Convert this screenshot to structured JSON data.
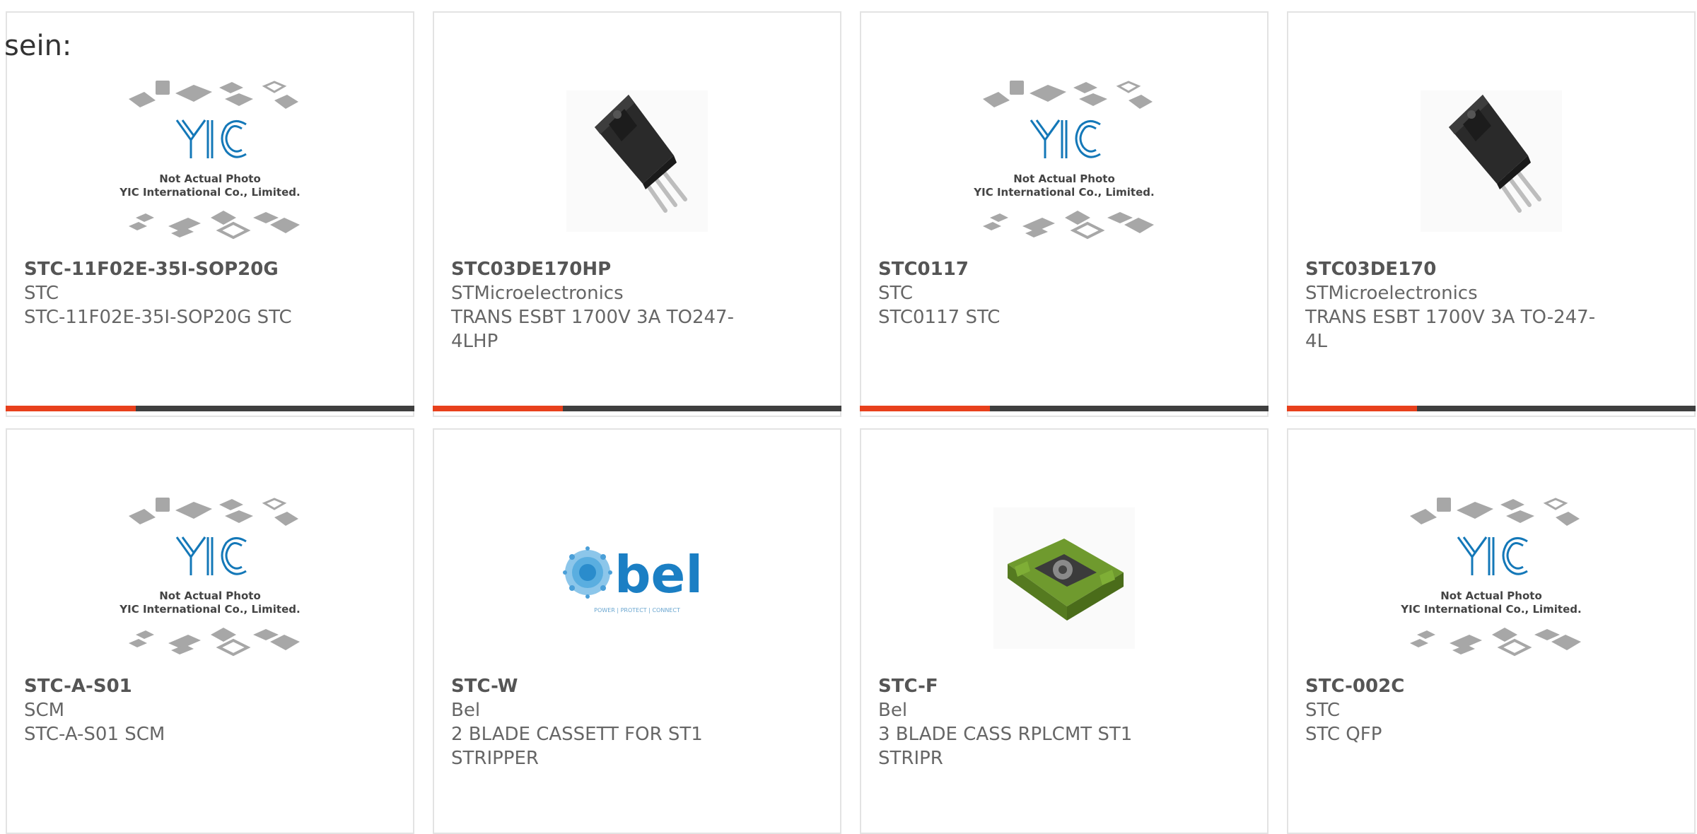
{
  "intro_text": "sein:",
  "placeholder_text": {
    "line1": "Not Actual Photo",
    "line2": "YIC International Co., Limited.",
    "logo": "YIC"
  },
  "bel_logo": {
    "name": "bel",
    "tagline": "POWER | PROTECT | CONNECT"
  },
  "colors": {
    "accent": "#e8401c",
    "bar": "#3f3f3f",
    "blue": "#1478b8",
    "border": "#e3e3e3"
  },
  "products": [
    {
      "part": "STC-11F02E-35I-SOP20G",
      "manufacturer": "STC",
      "description": "STC-11F02E-35I-SOP20G STC",
      "image": "yic-placeholder"
    },
    {
      "part": "STC03DE170HP",
      "manufacturer": "STMicroelectronics",
      "description": "TRANS ESBT 1700V 3A TO247-4LHP",
      "image": "to247-transistor"
    },
    {
      "part": "STC0117",
      "manufacturer": "STC",
      "description": "STC0117 STC",
      "image": "yic-placeholder"
    },
    {
      "part": "STC03DE170",
      "manufacturer": "STMicroelectronics",
      "description": "TRANS ESBT 1700V 3A TO-247-4L",
      "image": "to247-transistor"
    },
    {
      "part": "STC-A-S01",
      "manufacturer": "SCM",
      "description": "STC-A-S01 SCM",
      "image": "yic-placeholder"
    },
    {
      "part": "STC-W",
      "manufacturer": "Bel",
      "description": "2 BLADE CASSETT FOR ST1 STRIPPER",
      "image": "bel-logo"
    },
    {
      "part": "STC-F",
      "manufacturer": "Bel",
      "description": "3 BLADE CASS RPLCMT ST1 STRIPR",
      "image": "green-blade-cassette"
    },
    {
      "part": "STC-002C",
      "manufacturer": "STC",
      "description": "STC QFP",
      "image": "yic-placeholder"
    }
  ]
}
